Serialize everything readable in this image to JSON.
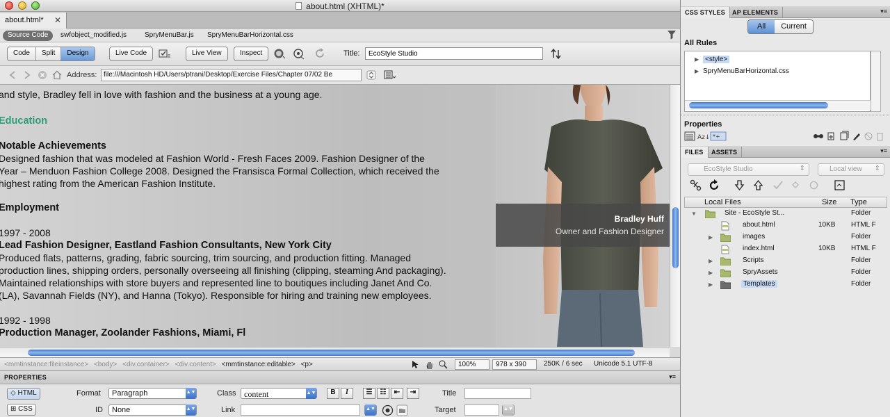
{
  "window": {
    "title": "about.html (XHTML)*"
  },
  "doc_tab": {
    "label": "about.html*",
    "close": "✕"
  },
  "related_files": {
    "source_code": "Source Code",
    "files": [
      "swfobject_modified.js",
      "SpryMenuBar.js",
      "SpryMenuBarHorizontal.css"
    ]
  },
  "toolbar": {
    "views": [
      "Code",
      "Split",
      "Design"
    ],
    "active_view": "Design",
    "live_code": "Live Code",
    "live_view": "Live View",
    "inspect": "Inspect",
    "title_label": "Title:",
    "title_value": "EcoStyle Studio"
  },
  "address": {
    "label": "Address:",
    "value": "file:///Macintosh HD/Users/ptrani/Desktop/Exercise Files/Chapter 07/02 Be"
  },
  "page_content": {
    "line1": "and style, Bradley fell in love with fashion and the business at a young age.",
    "education": "Education",
    "achievements_heading": "Notable Achievements",
    "achievements": [
      "Designed fashion that was modeled at Fashion World - Fresh Faces 2009.  Fashion Designer of the",
      "Year – Menduon Fashion College 2008.  Designed the Fransisca Formal Collection, which received the",
      "highest rating from the American Fashion Institute."
    ],
    "employment_heading": "Employment",
    "job1_years": "1997 - 2008",
    "job1_title": "Lead Fashion Designer, Eastland Fashion Consultants, New York City",
    "job1_desc": [
      "Produced flats, patterns, grading, fabric sourcing, trim sourcing, and production fitting. Managed",
      "production lines, shipping orders, personally overseeing all finishing (clipping, steaming And packaging).",
      "Maintained relationships with store buyers and represented line to boutiques including Janet And Co.",
      "(LA), Savannah Fields (NY), and Hanna (Tokyo). Responsible for hiring and training new employees."
    ],
    "job2_years": "1992 - 1998",
    "job2_title": "Production Manager, Zoolander Fashions, Miami, Fl"
  },
  "caption": {
    "name": "Bradley Huff",
    "role": "Owner and Fashion Designer"
  },
  "status": {
    "tags": [
      "<mmtinstance:fileinstance>",
      "<body>",
      "<div.container>",
      "<div.content>",
      "<mmtinstance:editable>",
      "<p>"
    ],
    "active_tag": "<mmtinstance:editable>",
    "zoom": "100%",
    "dimensions": "978 x 390",
    "size": "250K / 6 sec",
    "encoding": "Unicode 5.1 UTF-8"
  },
  "properties": {
    "header": "PROPERTIES",
    "html_btn": "HTML",
    "css_btn": "CSS",
    "format_label": "Format",
    "format_value": "Paragraph",
    "id_label": "ID",
    "id_value": "None",
    "class_label": "Class",
    "class_value": "content",
    "link_label": "Link",
    "link_value": "",
    "title_label": "Title",
    "target_label": "Target",
    "bold_btn": "B",
    "italic_btn": "I"
  },
  "css_panel": {
    "tab1": "CSS STYLES",
    "tab2": "AP ELEMENTS",
    "all": "All",
    "current": "Current",
    "all_rules": "All Rules",
    "rules": [
      "<style>",
      "SpryMenuBarHorizontal.css"
    ],
    "properties_title": "Properties"
  },
  "files_panel": {
    "tab1": "FILES",
    "tab2": "ASSETS",
    "site_select": "EcoStyle Studio",
    "view_select": "Local view",
    "columns": [
      "Local Files",
      "Size",
      "Type"
    ],
    "items": [
      {
        "name": "Site - EcoStyle St...",
        "size": "",
        "type": "Folder"
      },
      {
        "name": "about.html",
        "size": "10KB",
        "type": "HTML F"
      },
      {
        "name": "images",
        "size": "",
        "type": "Folder"
      },
      {
        "name": "index.html",
        "size": "10KB",
        "type": "HTML F"
      },
      {
        "name": "Scripts",
        "size": "",
        "type": "Folder"
      },
      {
        "name": "SpryAssets",
        "size": "",
        "type": "Folder"
      },
      {
        "name": "Templates",
        "size": "",
        "type": "Folder"
      }
    ]
  },
  "colors": {
    "accent_blue": "#5f90d4",
    "heading_green": "#2b9d76",
    "caption_bg": "#484848"
  },
  "icons": [
    "traffic-light-close",
    "filter-icon",
    "globe-icon",
    "refresh-icon",
    "back-arrow-icon",
    "forward-arrow-icon",
    "home-icon",
    "folder-icon",
    "gear-icon"
  ]
}
